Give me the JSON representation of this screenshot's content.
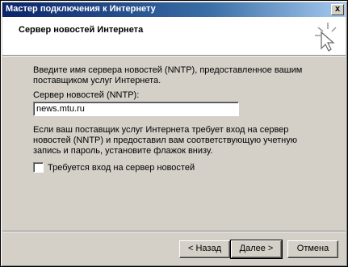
{
  "window": {
    "title": "Мастер подключения к Интернету",
    "close_label": "x"
  },
  "header": {
    "title": "Сервер новостей Интернета",
    "icon": "wizard-sparkle-icon"
  },
  "body": {
    "intro_text": "Введите имя сервера новостей (NNTP), предоставленное вашим поставщиком услуг Интернета.",
    "field_label": "Сервер новостей (NNTP):",
    "field_value": "news.mtu.ru",
    "info_text": "Если ваш поставщик услуг Интернета требует вход на сервер новостей (NNTP) и предоставил вам соответствующую учетную запись и пароль, установите флажок внизу.",
    "checkbox_label": "Требуется вход на сервер новостей",
    "checkbox_checked": false
  },
  "buttons": {
    "back": "< Назад",
    "next": "Далее >",
    "cancel": "Отмена"
  }
}
